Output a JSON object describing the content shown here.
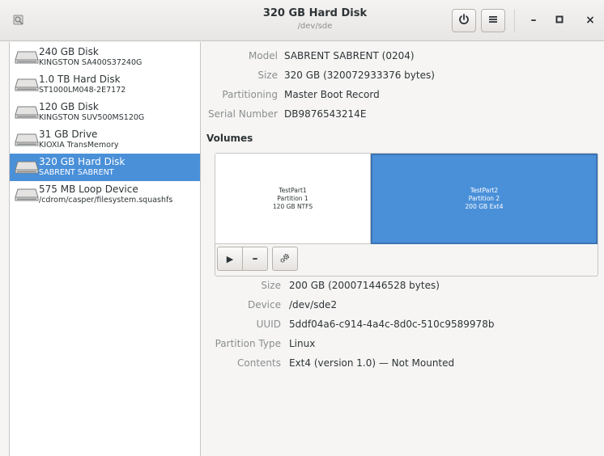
{
  "header": {
    "title": "320 GB Hard Disk",
    "subtitle": "/dev/sde",
    "left_icon": "disks-app-icon",
    "power_icon": "power-icon",
    "menu_icon": "hamburger-menu-icon",
    "minimize": "–",
    "maximize": "□",
    "close": "×"
  },
  "sidebar": {
    "items": [
      {
        "name": "240 GB Disk",
        "model": "KINGSTON SA400S37240G",
        "icon": "hard-disk-icon",
        "selected": false
      },
      {
        "name": "1.0 TB Hard Disk",
        "model": "ST1000LM048-2E7172",
        "icon": "hard-disk-icon",
        "selected": false
      },
      {
        "name": "120 GB Disk",
        "model": "KINGSTON SUV500MS120G",
        "icon": "hard-disk-icon",
        "selected": false
      },
      {
        "name": "31 GB Drive",
        "model": "KIOXIA TransMemory",
        "icon": "hard-disk-icon",
        "selected": false
      },
      {
        "name": "320 GB Hard Disk",
        "model": "SABRENT SABRENT",
        "icon": "hard-disk-icon",
        "selected": true
      },
      {
        "name": "575 MB Loop Device",
        "model": "/cdrom/casper/filesystem.squashfs",
        "icon": "hard-disk-icon",
        "selected": false
      }
    ]
  },
  "disk_info": {
    "model_label": "Model",
    "model": "SABRENT SABRENT (0204)",
    "size_label": "Size",
    "size": "320 GB (320072933376 bytes)",
    "partitioning_label": "Partitioning",
    "partitioning": "Master Boot Record",
    "serial_label": "Serial Number",
    "serial": "DB9876543214E"
  },
  "volumes": {
    "title": "Volumes",
    "partitions": [
      {
        "line1": "TestPart1",
        "line2": "Partition 1",
        "line3": "120 GB NTFS",
        "selected": false
      },
      {
        "line1": "TestPart2",
        "line2": "Partition 2",
        "line3": "200 GB Ext4",
        "selected": true
      }
    ],
    "toolbar": [
      "play-icon",
      "minus-icon",
      "gears-icon"
    ],
    "minus_glyph": "–",
    "play_glyph": "▶"
  },
  "partition_info": {
    "size_label": "Size",
    "size": "200 GB (200071446528 bytes)",
    "device_label": "Device",
    "device": "/dev/sde2",
    "uuid_label": "UUID",
    "uuid": "5ddf04a6-c914-4a4c-8d0c-510c9589978b",
    "type_label": "Partition Type",
    "type": "Linux",
    "contents_label": "Contents",
    "contents": "Ext4 (version 1.0) — Not Mounted"
  },
  "colors": {
    "accent": "#4a90d9",
    "sidebar_bg": "#ffffff",
    "window_bg": "#f6f5f4",
    "label_gray": "#8b8e8f"
  }
}
